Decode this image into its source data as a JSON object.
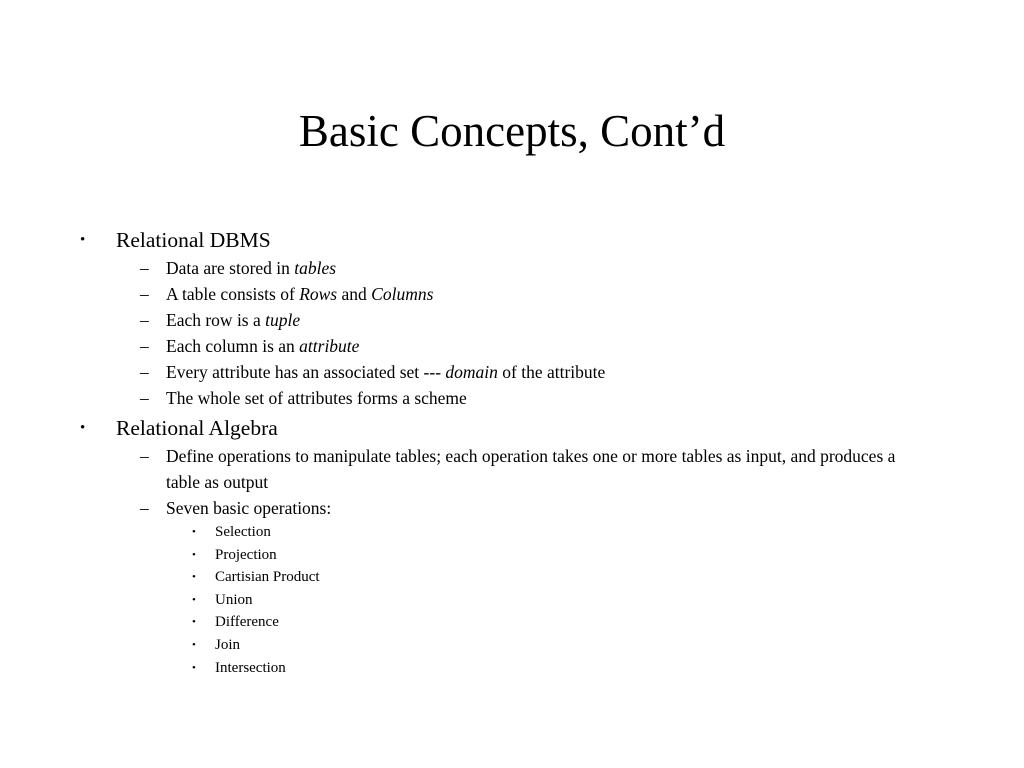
{
  "slide": {
    "title": "Basic Concepts, Cont’d",
    "background_color": "#ffffff",
    "text_color": "#000000",
    "markers": {
      "level1": "•",
      "level2": "–",
      "level3": "•"
    },
    "sections": [
      {
        "heading": "Relational DBMS",
        "items": [
          {
            "parts": [
              {
                "text": "Data are stored in ",
                "italic": false
              },
              {
                "text": "tables",
                "italic": true
              }
            ],
            "plain": "Data are stored in tables"
          },
          {
            "parts": [
              {
                "text": "A table consists of ",
                "italic": false
              },
              {
                "text": "Rows",
                "italic": true
              },
              {
                "text": " and ",
                "italic": false
              },
              {
                "text": "Columns",
                "italic": true
              }
            ],
            "plain": "A table consists of Rows and Columns"
          },
          {
            "parts": [
              {
                "text": "Each row is a ",
                "italic": false
              },
              {
                "text": "tuple",
                "italic": true
              }
            ],
            "plain": "Each row is a tuple"
          },
          {
            "parts": [
              {
                "text": "Each column is an ",
                "italic": false
              },
              {
                "text": "attribute",
                "italic": true
              }
            ],
            "plain": "Each column is an attribute"
          },
          {
            "parts": [
              {
                "text": "Every attribute has an associated set --- ",
                "italic": false
              },
              {
                "text": "domain",
                "italic": true
              },
              {
                "text": " of the attribute",
                "italic": false
              }
            ],
            "plain": "Every attribute has an associated set --- domain of the attribute"
          },
          {
            "parts": [
              {
                "text": "The whole set of attributes forms a scheme",
                "italic": false
              }
            ],
            "plain": "The whole set of attributes forms a scheme"
          }
        ]
      },
      {
        "heading": "Relational Algebra",
        "items": [
          {
            "parts": [
              {
                "text": "Define operations to manipulate tables; each operation takes one or more tables as input, and produces a table as output",
                "italic": false
              }
            ],
            "plain": "Define operations to manipulate tables; each operation takes one or more tables as input, and produces a table as output"
          },
          {
            "parts": [
              {
                "text": "Seven basic operations:",
                "italic": false
              }
            ],
            "plain": "Seven basic operations:",
            "sub_items": [
              "Selection",
              "Projection",
              "Cartisian Product",
              "Union",
              "Difference",
              "Join",
              "Intersection"
            ]
          }
        ]
      }
    ]
  }
}
